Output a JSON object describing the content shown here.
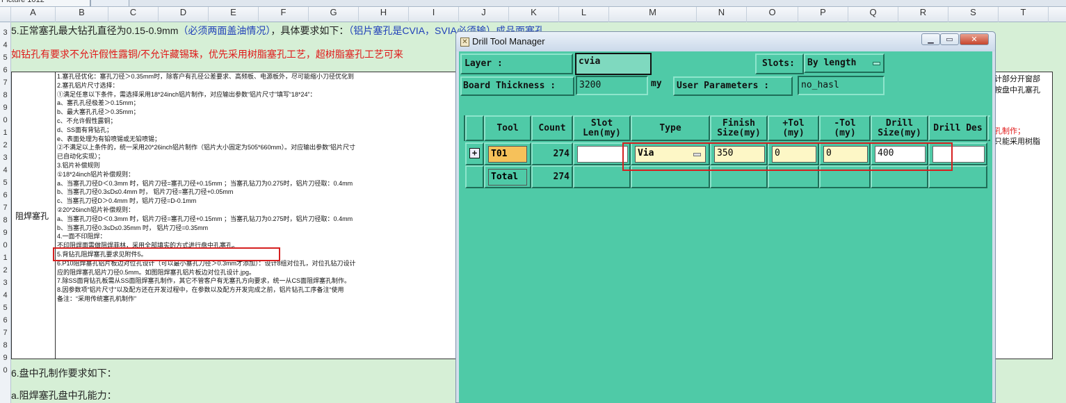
{
  "sheet_tab": {
    "name": "Picture 1012"
  },
  "columns": [
    "A",
    "B",
    "C",
    "D",
    "E",
    "F",
    "G",
    "H",
    "I",
    "J",
    "K",
    "L",
    "M",
    "N",
    "O",
    "P",
    "Q",
    "R",
    "S",
    "T"
  ],
  "row_labels": [
    "3",
    "4",
    "5",
    "6",
    "7",
    "8",
    "9",
    "0",
    "1",
    "2",
    "3",
    "4",
    "5",
    "6",
    "7",
    "8",
    "9",
    "0",
    "1",
    "2",
    "3",
    "4",
    "5",
    "6",
    "7",
    "8",
    "9",
    "0"
  ],
  "sheet": {
    "line1_a": "5.正常塞孔最大钻孔直径为0.15-0.9mm",
    "line1_b": "（必须两面盖油情况）",
    "line1_c": "，具体要求如下：",
    "line1_d": "（铝片塞孔是CVIA，SVIA必须输）成品面塞孔",
    "line2": "如钻孔有要求不允许假性露铜/不允许藏锡珠，优先采用树脂塞孔工艺，超树脂塞孔工艺可来",
    "cell_label": "阻焊塞孔",
    "content_lines": [
      "1.塞孔径优化：塞孔刀径＞0.35mm时，除客户有孔径公差要求、高频板、电源板外，尽可能缩小刀径优化到",
      "2.塞孔铝片尺寸选择：",
      "①满足任意以下条件，需选择采用18*24inch铝片制作，对应输出参数“铝片尺寸”填写“18*24”：",
      "a、塞孔孔径极差＞0.15mm；",
      "b、最大塞孔孔径＞0.35mm；",
      "c、不允许假性露铜；",
      "d、SS面有背钻孔；",
      "e、表面处理为有铅喷锡或无铅喷锡；",
      "②不满足以上条件的，统一采用20*26inch铝片制作（铝片大小固定为505*660mm）。对应输出参数“铝片尺寸",
      "已自动化实现）；",
      "3.铝片补偿规则",
      "①18*24inch铝片补偿规则：",
      "a、当塞孔刀径D＜0.3mm 时，铝片刀径=塞孔刀径+0.15mm ；当塞孔钻刀为0.275时，铝片刀径取：0.4mm",
      "b、当塞孔刀径0.3≤D≤0.4mm 时， 铝片刀径=塞孔刀径+0.05mm",
      "c、当塞孔刀径D＞0.4mm 时，铝片刀径=D-0.1mm",
      "②20*26inch铝片补偿规则：",
      "a、当塞孔刀径D＜0.3mm 时，铝片刀径=塞孔刀径+0.15mm ；当塞孔钻刀为0.275时，铝片刀径取：0.4mm",
      "b、当塞孔刀径0.3≤D≤0.35mm 时， 铝片刀径=0.35mm",
      "4.一面不印阻焊：",
      "不印阻焊面需做阻焊菲林，采用全部填实的方式进行盘中孔塞孔。",
      "5.背钻孔阻焊塞孔要求见附件5。",
      "6.P10阻焊塞孔铝片板边对位孔设计（可以最小塞孔刀径＞0.3mm才添加）：设计8组对位孔，对位孔钻刀设计",
      "应的阻焊塞孔铝片刀径0.5mm。如图阻焊塞孔铝片板边对位孔设计.jpg。",
      "7.除SS面背钻孔板需从SS面阻焊塞孔制作，其它不管客户有无塞孔方向要求，统一从CS面阻焊塞孔制作。",
      "8.因参数项“铝片尺寸”以及配方还在开发过程中，在参数以及配方开发完成之前，铝片钻孔工序备注“使用",
      "备注：“采用传统塞孔机制作”"
    ],
    "right_1": "计部分开窗部",
    "right_2": "按盘中孔塞孔",
    "right_3": "孔制作；",
    "right_4": "只能采用树脂",
    "line6": "6.盘中孔制作要求如下：",
    "line_a": "a.阻焊塞孔盘中孔能力："
  },
  "dialog": {
    "title": "Drill Tool Manager",
    "layer_label": "Layer          :",
    "layer_value": "cvia",
    "slots_label": "Slots:",
    "slots_value": "By length",
    "board_thickness_label": "Board Thickness :",
    "board_thickness_value": "3200",
    "board_thickness_unit": "my",
    "user_params_button": "User Parameters :",
    "user_params_value": "no_hasl",
    "headers": [
      "Tool",
      "Count",
      "Slot Len(my)",
      "Type",
      "Finish Size(my)",
      "+Tol (my)",
      "-Tol (my)",
      "Drill Size(my)",
      "Drill Des"
    ],
    "rows": [
      {
        "tool": "T01",
        "count": "274",
        "slot_len": "",
        "type": "Via",
        "finish_size": "350",
        "plus_tol": "0",
        "minus_tol": "0",
        "drill_size": "400",
        "drill_des": ""
      }
    ],
    "total": {
      "label": "Total",
      "count": "274"
    }
  },
  "colors": {
    "dialog_bg": "#4fcaa7",
    "tool_button": "#f6c15a",
    "highlight": "#d62020",
    "sheet_bg": "#d6efd6"
  }
}
